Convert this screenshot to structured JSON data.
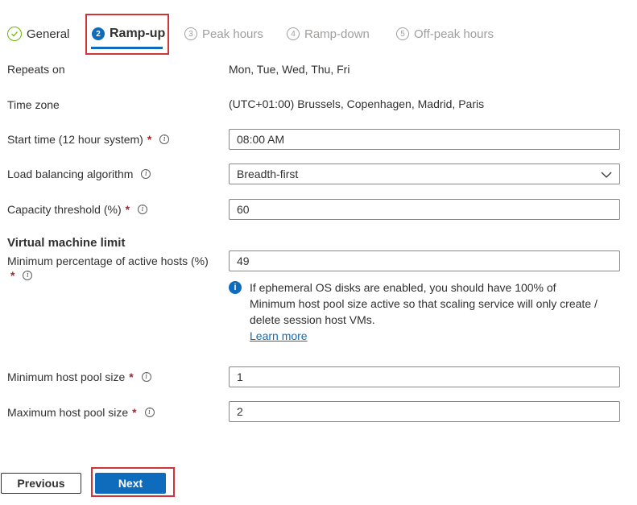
{
  "tabs": [
    {
      "label": "General",
      "state": "completed"
    },
    {
      "num": "2",
      "label": "Ramp-up",
      "state": "active"
    },
    {
      "num": "3",
      "label": "Peak hours",
      "state": "disabled"
    },
    {
      "num": "4",
      "label": "Ramp-down",
      "state": "disabled"
    },
    {
      "num": "5",
      "label": "Off-peak hours",
      "state": "disabled"
    }
  ],
  "form": {
    "repeats_on": {
      "label": "Repeats on",
      "value": "Mon, Tue, Wed, Thu, Fri"
    },
    "time_zone": {
      "label": "Time zone",
      "value": "(UTC+01:00) Brussels, Copenhagen, Madrid, Paris"
    },
    "start_time": {
      "label": "Start time (12 hour system)",
      "required": "*",
      "value": "08:00 AM"
    },
    "load_balancing": {
      "label": "Load balancing algorithm",
      "value": "Breadth-first"
    },
    "capacity_threshold": {
      "label": "Capacity threshold (%)",
      "required": "*",
      "value": "60"
    },
    "vm_limit_title": "Virtual machine limit",
    "min_active_hosts": {
      "label": "Minimum percentage of active hosts (%)",
      "required": "*",
      "value": "49"
    },
    "info_message": {
      "text": "If ephemeral OS disks are enabled, you should have 100% of Minimum host pool size active so that scaling service will only create / delete session host VMs.",
      "link": "Learn more"
    },
    "min_pool_size": {
      "label": "Minimum host pool size",
      "required": "*",
      "value": "1"
    },
    "max_pool_size": {
      "label": "Maximum host pool size",
      "required": "*",
      "value": "2"
    }
  },
  "buttons": {
    "previous": "Previous",
    "next": "Next"
  },
  "colors": {
    "accent": "#0f6cbd",
    "highlight": "#d13438",
    "success": "#6bb700",
    "required": "#a4262c"
  }
}
